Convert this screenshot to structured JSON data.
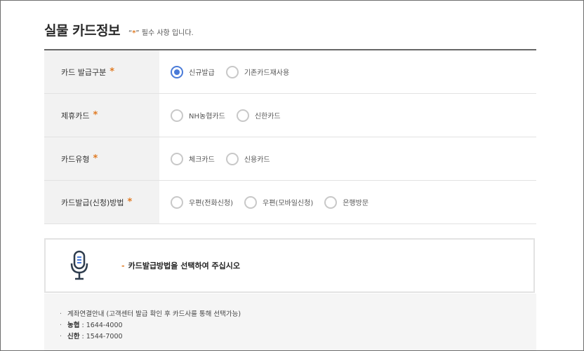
{
  "header": {
    "title": "실물 카드정보",
    "note_open": "“",
    "note_asterisk": "*",
    "note_rest": "” 필수 사항 입니다."
  },
  "form": {
    "required_mark": "*",
    "rows": [
      {
        "label": "카드 발급구분",
        "options": [
          {
            "label": "신규발급",
            "checked": true
          },
          {
            "label": "기존카드재사용",
            "checked": false
          }
        ]
      },
      {
        "label": "제휴카드",
        "options": [
          {
            "label": "NH농협카드",
            "checked": false
          },
          {
            "label": "신한카드",
            "checked": false
          }
        ]
      },
      {
        "label": "카드유형",
        "options": [
          {
            "label": "체크카드",
            "checked": false
          },
          {
            "label": "신용카드",
            "checked": false
          }
        ]
      },
      {
        "label": "카드발급(신청)방법",
        "options": [
          {
            "label": "우편(전화신청)",
            "checked": false
          },
          {
            "label": "우편(모바일신청)",
            "checked": false
          },
          {
            "label": "은행방문",
            "checked": false
          }
        ]
      }
    ]
  },
  "info": {
    "icon": "microphone-icon",
    "dash": "-",
    "text": "카드발급방법을 선택하여 주십시오"
  },
  "bottom": {
    "bullet": "·",
    "line1": "계좌연결안내 (고객센터 발급 확인 후 카드사를 통해 선택가능)",
    "line2_name": "농협",
    "line2_value": " : 1644-4000",
    "line3_name": "신한",
    "line3_value": " : 1544-7000"
  },
  "colors": {
    "accent": "#e07a22",
    "radio_selected": "#4a7bd8"
  }
}
